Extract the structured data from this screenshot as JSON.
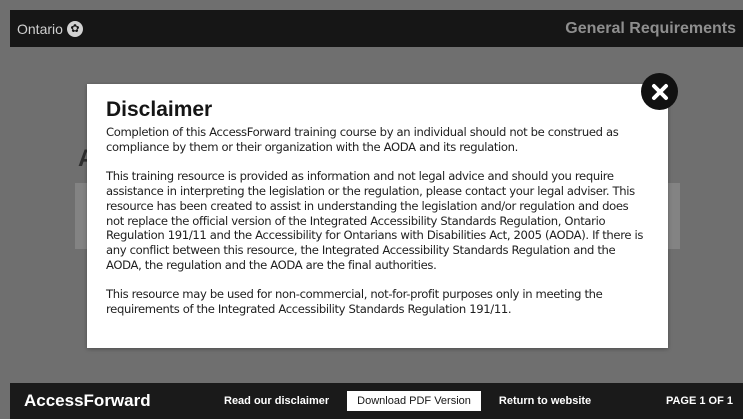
{
  "topbar": {
    "brand": "Ontario",
    "brand_icon": "trillium-icon",
    "page_title": "General Requirements"
  },
  "background": {
    "heading_fragment": "A"
  },
  "modal": {
    "title": "Disclaimer",
    "paragraphs": [
      "Completion of this AccessForward training course by an individual should not be construed as compliance by them or their organization with the AODA and its regulation.",
      "This training resource is provided as information and not legal advice and should you require assistance in interpreting the legislation or the regulation, please contact your legal adviser. This resource has been created to assist in understanding the legislation and/or regulation and does not replace the official version of the Integrated Accessibility Standards Regulation, Ontario Regulation 191/11 and the Accessibility for Ontarians with Disabilities Act, 2005 (AODA). If there is any conflict between this resource, the Integrated Accessibility Standards Regulation and the AODA, the regulation and the AODA are the final authorities.",
      "This resource may be used for non-commercial, not-for-profit purposes only in meeting the requirements of the Integrated Accessibility Standards Regulation 191/11."
    ],
    "close_icon": "close-icon"
  },
  "bottombar": {
    "logo": "AccessForward",
    "disclaimer_link": "Read our disclaimer",
    "download_button": "Download PDF Version",
    "return_link": "Return to website",
    "page_indicator": "PAGE 1 OF 1"
  },
  "colors": {
    "overlay": "#6f6f6f",
    "bar": "#161616",
    "modal": "#ffffff",
    "close_button": "#111111"
  }
}
